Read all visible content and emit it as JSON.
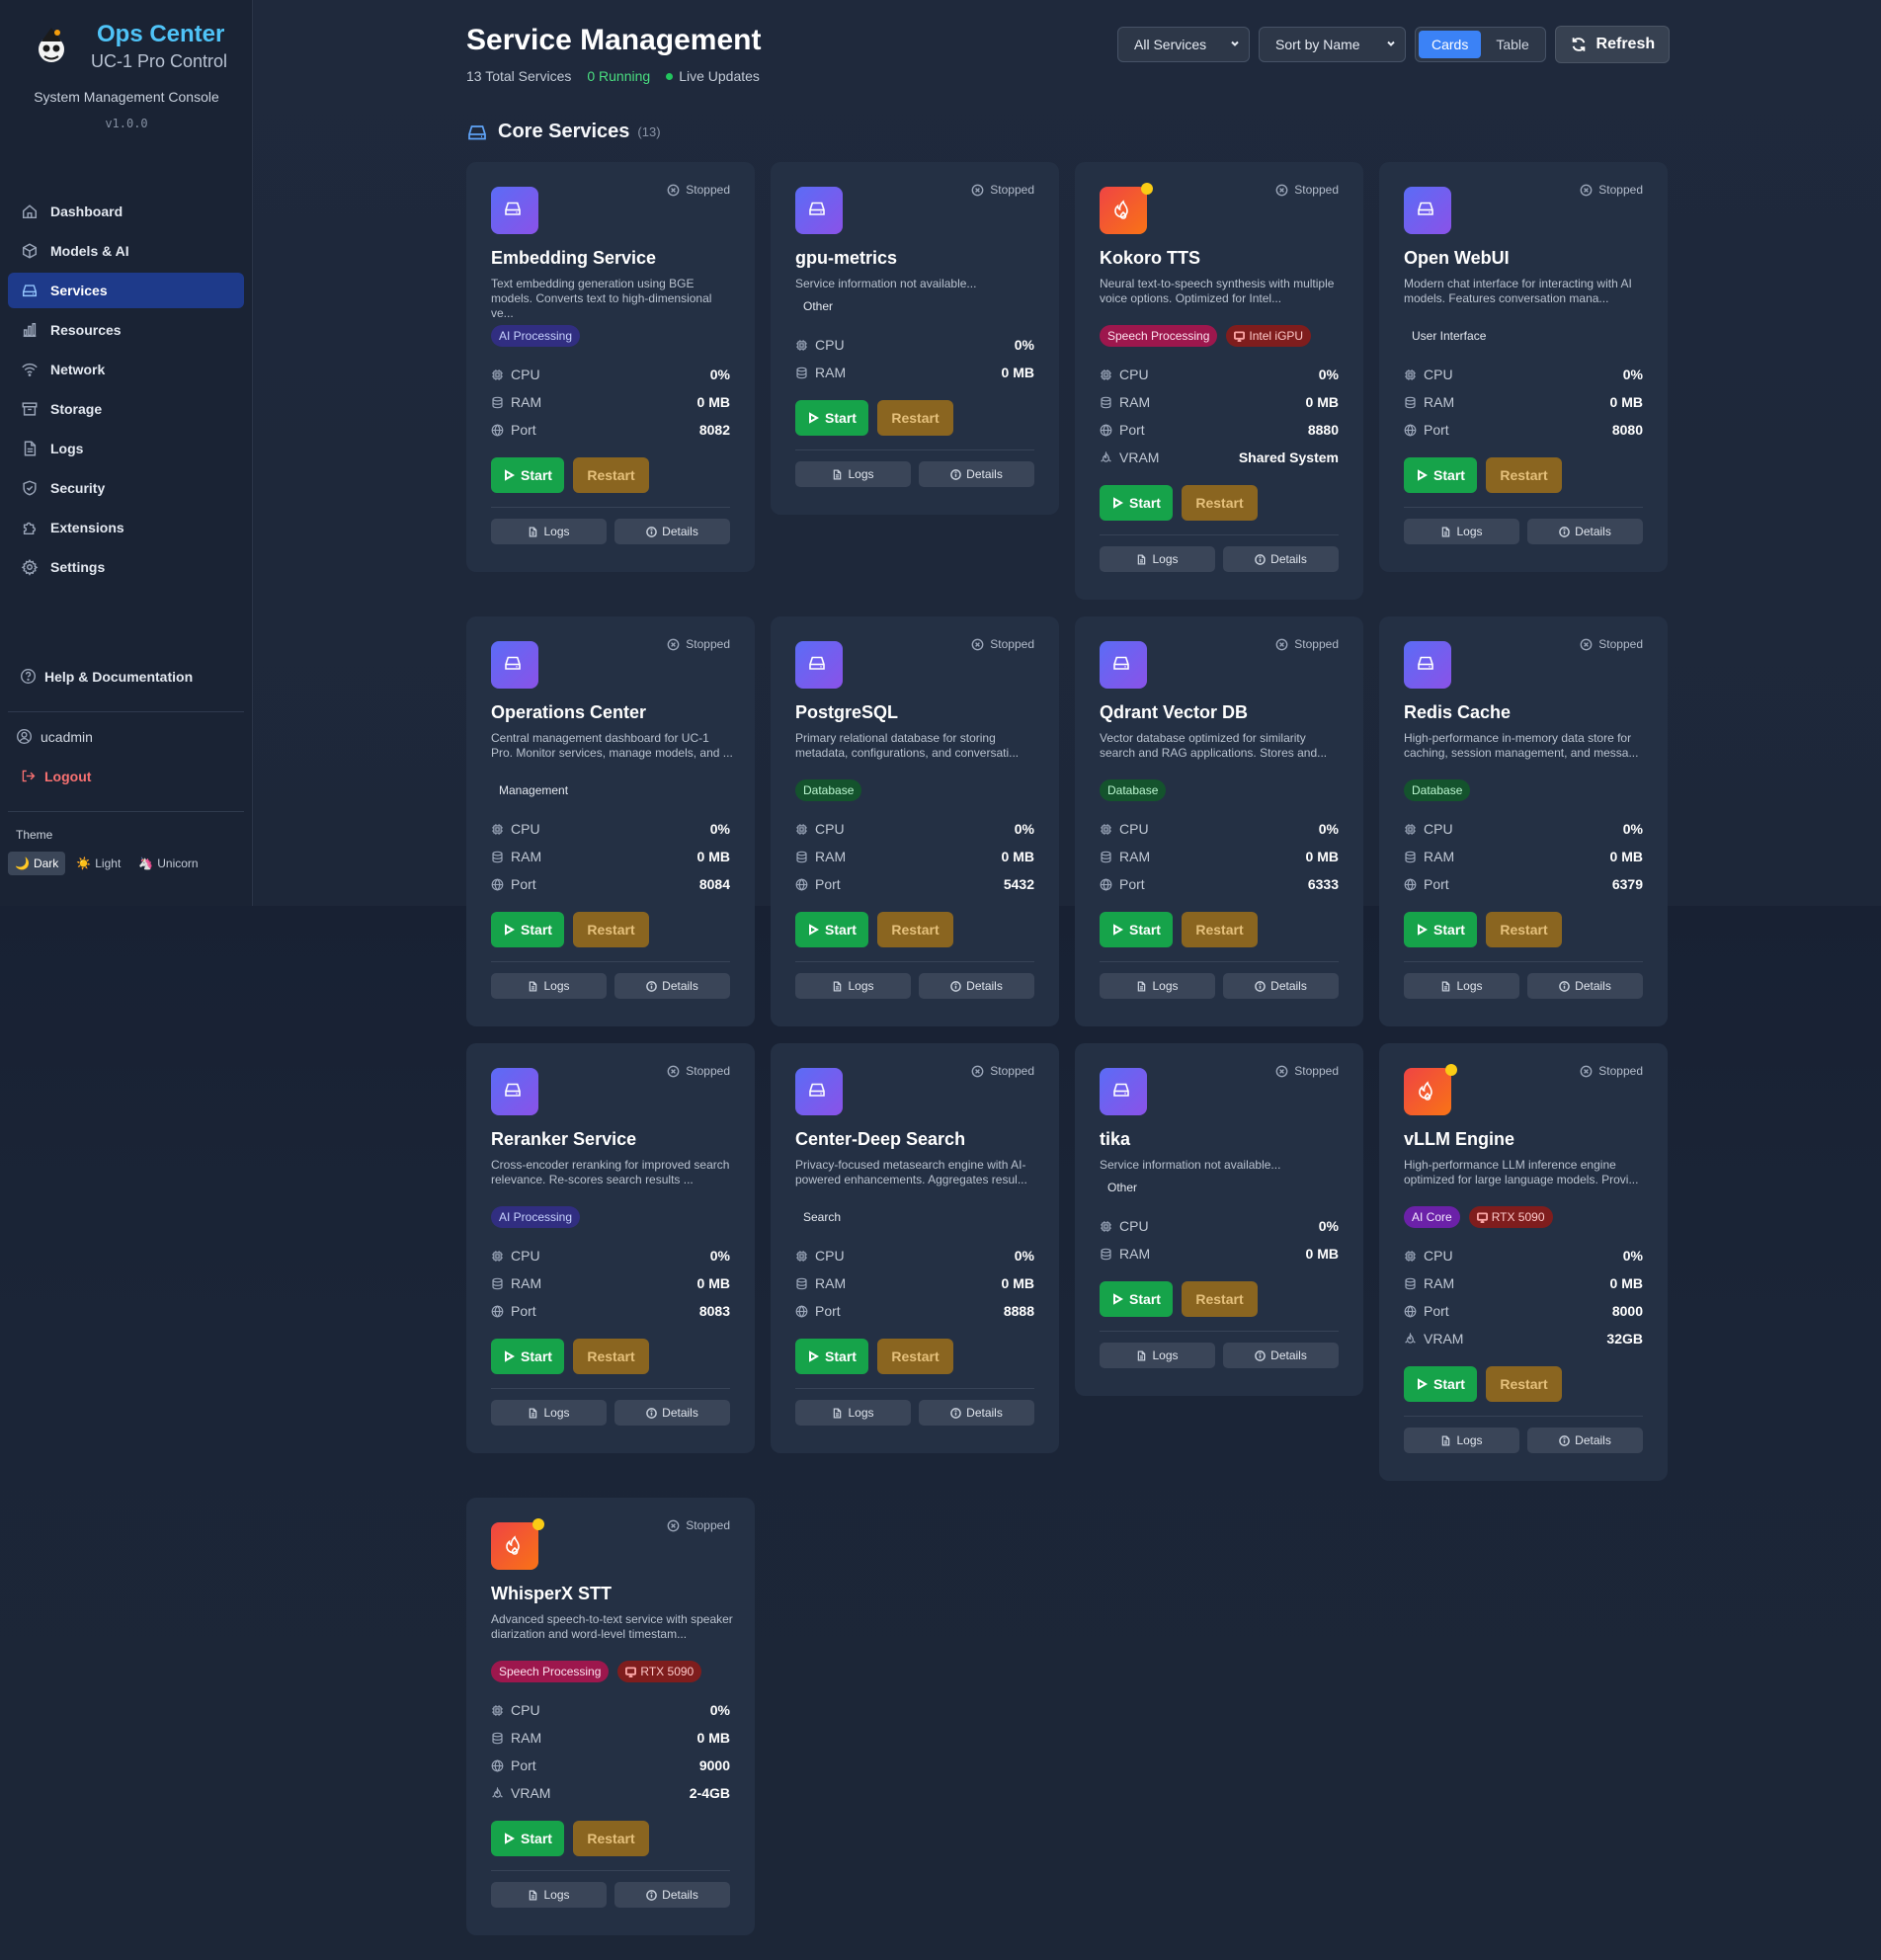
{
  "sidebar": {
    "brand_title": "Ops Center",
    "brand_subtitle": "UC-1 Pro Control",
    "console_label": "System Management Console",
    "version": "v1.0.0",
    "nav": [
      {
        "label": "Dashboard",
        "icon": "home-icon"
      },
      {
        "label": "Models & AI",
        "icon": "cube-icon"
      },
      {
        "label": "Services",
        "icon": "server-icon",
        "active": true
      },
      {
        "label": "Resources",
        "icon": "chart-icon"
      },
      {
        "label": "Network",
        "icon": "wifi-icon"
      },
      {
        "label": "Storage",
        "icon": "archive-icon"
      },
      {
        "label": "Logs",
        "icon": "document-icon"
      },
      {
        "label": "Security",
        "icon": "shield-icon"
      },
      {
        "label": "Extensions",
        "icon": "puzzle-icon"
      },
      {
        "label": "Settings",
        "icon": "gear-icon"
      }
    ],
    "help_label": "Help & Documentation",
    "username": "ucadmin",
    "logout_label": "Logout",
    "theme_label": "Theme",
    "themes": [
      {
        "label": "Dark",
        "icon": "🌙",
        "active": true
      },
      {
        "label": "Light",
        "icon": "☀️"
      },
      {
        "label": "Unicorn",
        "icon": "🦄"
      }
    ]
  },
  "header": {
    "title": "Service Management",
    "total_services": "13 Total Services",
    "running": "0 Running",
    "live": "Live Updates",
    "filter_value": "All Services",
    "sort_value": "Sort by Name",
    "view_cards": "Cards",
    "view_table": "Table",
    "refresh_label": "Refresh"
  },
  "section": {
    "title": "Core Services",
    "count": "(13)"
  },
  "labels": {
    "cpu": "CPU",
    "ram": "RAM",
    "port": "Port",
    "vram": "VRAM",
    "start": "Start",
    "restart": "Restart",
    "logs": "Logs",
    "details": "Details"
  },
  "colors": {
    "accent": "#3b82f6",
    "running": "#4ade80",
    "start_button": "#16a34a",
    "restart_button": "#8a6520",
    "gpu_indicator": "#facc15"
  },
  "services": [
    {
      "name": "Embedding Service",
      "status": "Stopped",
      "desc": "Text embedding generation using BGE models. Converts text to high-dimensional ve...",
      "icon": "server-icon",
      "gpu": false,
      "tags": [
        {
          "label": "AI Processing",
          "kind": "ai"
        }
      ],
      "cpu": "0%",
      "ram": "0 MB",
      "port": "8082"
    },
    {
      "name": "gpu-metrics",
      "status": "Stopped",
      "desc": "Service information not available...",
      "icon": "server-icon",
      "gpu": false,
      "tags": [
        {
          "label": "Other",
          "kind": "plain"
        }
      ],
      "cpu": "0%",
      "ram": "0 MB"
    },
    {
      "name": "Kokoro TTS",
      "status": "Stopped",
      "desc": "Neural text-to-speech synthesis with multiple voice options. Optimized for Intel...",
      "icon": "fire-icon",
      "gpu": true,
      "tags": [
        {
          "label": "Speech Processing",
          "kind": "speech"
        },
        {
          "label": "Intel iGPU",
          "kind": "hw"
        }
      ],
      "cpu": "0%",
      "ram": "0 MB",
      "port": "8880",
      "vram": "Shared System"
    },
    {
      "name": "Open WebUI",
      "status": "Stopped",
      "desc": "Modern chat interface for interacting with AI models. Features conversation mana...",
      "icon": "server-icon",
      "gpu": false,
      "tags": [
        {
          "label": "User Interface",
          "kind": "plain"
        }
      ],
      "cpu": "0%",
      "ram": "0 MB",
      "port": "8080"
    },
    {
      "name": "Operations Center",
      "status": "Stopped",
      "desc": "Central management dashboard for UC-1 Pro. Monitor services, manage models, and ...",
      "icon": "server-icon",
      "gpu": false,
      "tags": [
        {
          "label": "Management",
          "kind": "plain"
        }
      ],
      "cpu": "0%",
      "ram": "0 MB",
      "port": "8084"
    },
    {
      "name": "PostgreSQL",
      "status": "Stopped",
      "desc": "Primary relational database for storing metadata, configurations, and conversati...",
      "icon": "server-icon",
      "gpu": false,
      "tags": [
        {
          "label": "Database",
          "kind": "db"
        }
      ],
      "cpu": "0%",
      "ram": "0 MB",
      "port": "5432"
    },
    {
      "name": "Qdrant Vector DB",
      "status": "Stopped",
      "desc": "Vector database optimized for similarity search and RAG applications. Stores and...",
      "icon": "server-icon",
      "gpu": false,
      "tags": [
        {
          "label": "Database",
          "kind": "db"
        }
      ],
      "cpu": "0%",
      "ram": "0 MB",
      "port": "6333"
    },
    {
      "name": "Redis Cache",
      "status": "Stopped",
      "desc": "High-performance in-memory data store for caching, session management, and messa...",
      "icon": "server-icon",
      "gpu": false,
      "tags": [
        {
          "label": "Database",
          "kind": "db"
        }
      ],
      "cpu": "0%",
      "ram": "0 MB",
      "port": "6379"
    },
    {
      "name": "Reranker Service",
      "status": "Stopped",
      "desc": "Cross-encoder reranking for improved search relevance. Re-scores search results ...",
      "icon": "server-icon",
      "gpu": false,
      "tags": [
        {
          "label": "AI Processing",
          "kind": "ai"
        }
      ],
      "cpu": "0%",
      "ram": "0 MB",
      "port": "8083"
    },
    {
      "name": "Center-Deep Search",
      "status": "Stopped",
      "desc": "Privacy-focused metasearch engine with AI-powered enhancements. Aggregates resul...",
      "icon": "server-icon",
      "gpu": false,
      "tags": [
        {
          "label": "Search",
          "kind": "plain"
        }
      ],
      "cpu": "0%",
      "ram": "0 MB",
      "port": "8888"
    },
    {
      "name": "tika",
      "status": "Stopped",
      "desc": "Service information not available...",
      "icon": "server-icon",
      "gpu": false,
      "tags": [
        {
          "label": "Other",
          "kind": "plain"
        }
      ],
      "cpu": "0%",
      "ram": "0 MB"
    },
    {
      "name": "vLLM Engine",
      "status": "Stopped",
      "desc": "High-performance LLM inference engine optimized for large language models. Provi...",
      "icon": "fire-icon",
      "gpu": true,
      "tags": [
        {
          "label": "AI Core",
          "kind": "aicore"
        },
        {
          "label": "RTX 5090",
          "kind": "hw"
        }
      ],
      "cpu": "0%",
      "ram": "0 MB",
      "port": "8000",
      "vram": "32GB"
    },
    {
      "name": "WhisperX STT",
      "status": "Stopped",
      "desc": "Advanced speech-to-text service with speaker diarization and word-level timestam...",
      "icon": "fire-icon",
      "gpu": true,
      "tags": [
        {
          "label": "Speech Processing",
          "kind": "speech"
        },
        {
          "label": "RTX 5090",
          "kind": "hw"
        }
      ],
      "cpu": "0%",
      "ram": "0 MB",
      "port": "9000",
      "vram": "2-4GB"
    }
  ]
}
